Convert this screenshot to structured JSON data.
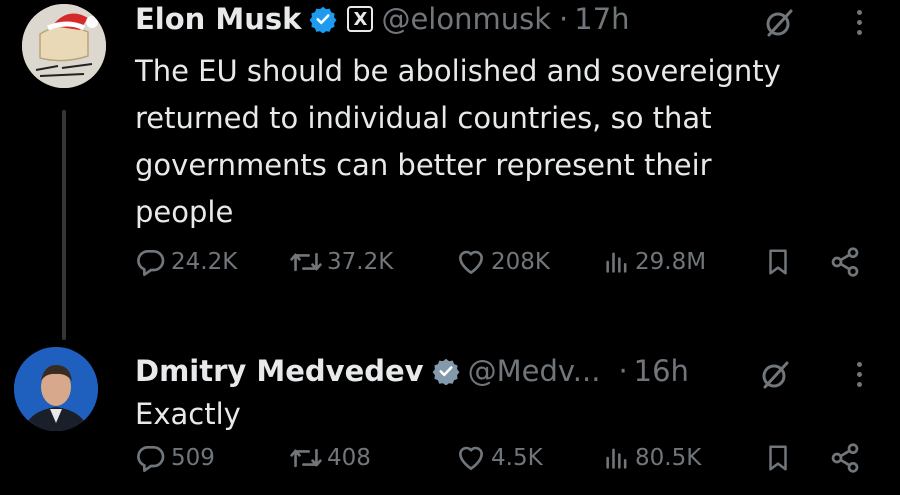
{
  "tweets": [
    {
      "author": {
        "name": "Elon Musk",
        "handle": "@elonmusk",
        "affiliate_badge": "X"
      },
      "time_separator": "·",
      "time": "17h",
      "text": "The EU should be abolished and sovereignty\nreturned to individual countries, so that\ngovernments can better represent their\npeople",
      "stats": {
        "replies": "24.2K",
        "reposts": "37.2K",
        "likes": "208K",
        "views": "29.8M"
      }
    },
    {
      "author": {
        "name": "Dmitry Medvedev",
        "handle": "@Medv..."
      },
      "time_separator": "·",
      "time": "16h",
      "text": "Exactly",
      "stats": {
        "replies": "509",
        "reposts": "408",
        "likes": "4.5K",
        "views": "80.5K"
      }
    }
  ],
  "icons": {
    "verified": "verified-badge-icon",
    "grok": "grok-icon",
    "more": "more-options-icon",
    "reply": "reply-icon",
    "repost": "repost-icon",
    "like": "like-icon",
    "views": "views-icon",
    "bookmark": "bookmark-icon",
    "share": "share-icon"
  },
  "colors": {
    "background": "#000000",
    "text_primary": "#e7e9ea",
    "text_secondary": "#71767b",
    "verified_blue": "#1d9bf0",
    "verified_gray": "#829aab"
  }
}
